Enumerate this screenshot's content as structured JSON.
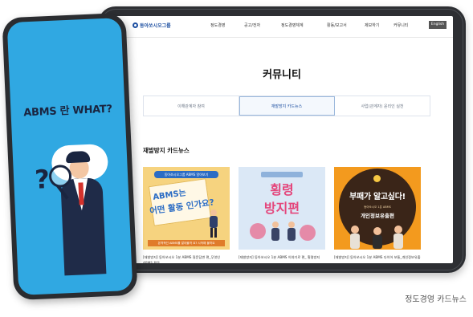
{
  "site": {
    "logo_text": "동아쏘시오그룹",
    "nav": [
      "정도경영",
      "공고/전자",
      "정도경영체계",
      "활동/보고서",
      "제보하기",
      "커뮤니티"
    ],
    "lang_button": "English"
  },
  "page": {
    "title": "커뮤니티",
    "tabs": [
      {
        "label": "이해관계자 참여",
        "active": false
      },
      {
        "label": "재발방지 카드뉴스",
        "active": true
      },
      {
        "label": "사업(관계자) 윤리인 실천",
        "active": false
      }
    ],
    "section_title": "재발방지 카드뉴스"
  },
  "cards": [
    {
      "banner": "동아쏘시오그룹 ABMS 알아보기",
      "line1": "ABMS는",
      "line2": "어떤 활동 인가요?",
      "footer": "본격적인 ABMS를 알아볼까 요? 시작해 볼까요",
      "caption": "[재발방지] 동아쏘시오 1분 ABMS 질문답변 편_무엇인 ABMS 활동"
    },
    {
      "line1": "횡령",
      "line2": "방지편",
      "caption": "[재발방지] 동아쏘시오 1분 ABMS 이야기로 편_ 횡령방지"
    },
    {
      "line1": "부패가 알고싶다!",
      "sub": "동아쏘시오 1분 ABMS",
      "line2": "개인정보유출편",
      "caption": "[재발방지] 동아쏘시오 1분 ABMS 다이어 보통_개인정보유출"
    }
  ],
  "phone": {
    "headline": "ABMS 란 WHAT?"
  },
  "caption": "정도경영 카드뉴스",
  "colors": {
    "brand": "#1d4fa1",
    "phone_bg": "#30a8e2",
    "card1_bg": "#f6d37f",
    "card2_bg": "#dbe8f6",
    "card3_bg": "#f39a1e",
    "accent_pink": "#e4457b"
  }
}
